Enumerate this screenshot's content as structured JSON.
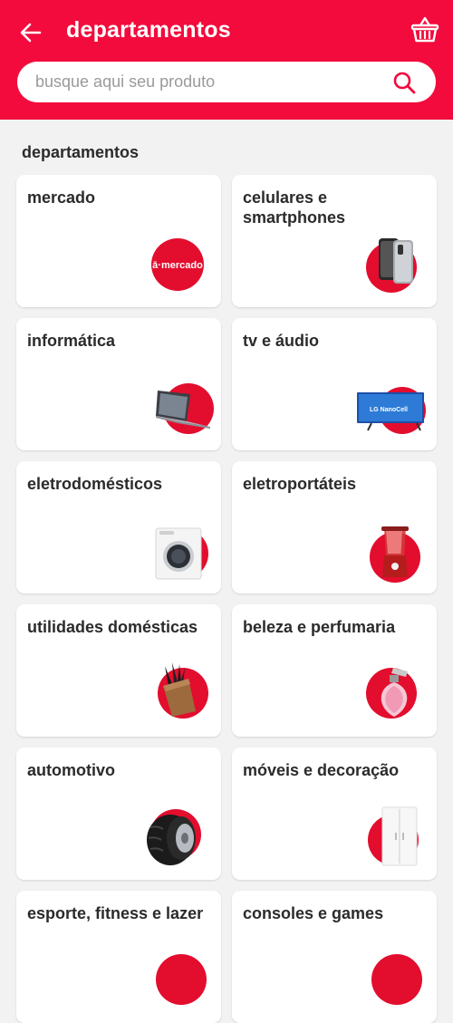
{
  "header": {
    "title": "departamentos",
    "back_icon": "arrow-left-icon",
    "cart_icon": "basket-icon",
    "background": "#f20b3c"
  },
  "search": {
    "placeholder": "busque aqui seu produto",
    "value": "",
    "icon": "search-icon"
  },
  "section": {
    "title": "departamentos"
  },
  "departments": [
    {
      "label": "mercado",
      "icon": "mercado-logo-icon"
    },
    {
      "label": "celulares e smartphones",
      "icon": "smartphone-icon"
    },
    {
      "label": "informática",
      "icon": "laptop-icon"
    },
    {
      "label": "tv e áudio",
      "icon": "tv-icon"
    },
    {
      "label": "eletrodomésticos",
      "icon": "washing-machine-icon"
    },
    {
      "label": "eletroportáteis",
      "icon": "blender-icon"
    },
    {
      "label": "utilidades domésticas",
      "icon": "knife-block-icon"
    },
    {
      "label": "beleza e perfumaria",
      "icon": "perfume-icon"
    },
    {
      "label": "automotivo",
      "icon": "tire-icon"
    },
    {
      "label": "móveis e decoração",
      "icon": "wardrobe-icon"
    },
    {
      "label": "esporte, fitness e lazer",
      "icon": "sport-icon"
    },
    {
      "label": "consoles e games",
      "icon": "console-icon"
    }
  ],
  "logo_text": "ā·mercado",
  "tv_brand_text": "LG NanoCell",
  "colors": {
    "accent": "#f20b3c",
    "card_circle": "#e30d2e",
    "page_bg": "#f2f2f2"
  }
}
